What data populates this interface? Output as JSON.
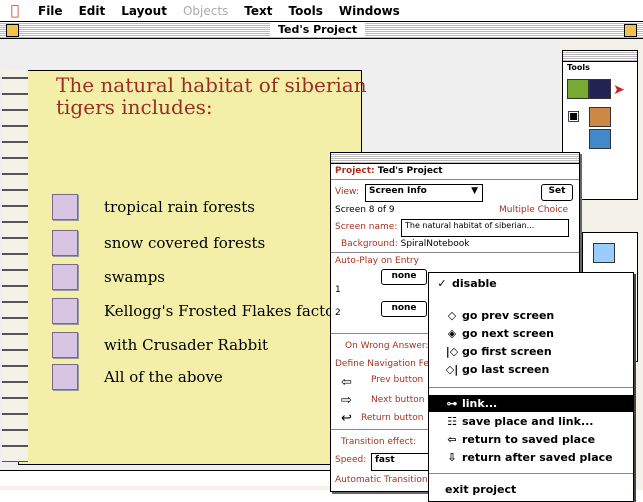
{
  "menubar": {
    "items": [
      {
        "label": "File",
        "enabled": true
      },
      {
        "label": "Edit",
        "enabled": true
      },
      {
        "label": "Layout",
        "enabled": true
      },
      {
        "label": "Objects",
        "enabled": false
      },
      {
        "label": "Text",
        "enabled": true
      },
      {
        "label": "Tools",
        "enabled": true
      },
      {
        "label": "Windows",
        "enabled": true
      }
    ]
  },
  "window": {
    "title": "Ted's Project"
  },
  "screen": {
    "question": "The natural habitat of siberian tigers includes:",
    "choices": [
      "tropical rain forests",
      "snow covered forests",
      "swamps",
      "Kellogg's Frosted Flakes factor",
      "with Crusader Rabbit",
      "All of the above"
    ],
    "colors": {
      "page": "#f3efa9",
      "question": "#9a2e23",
      "checkbox": "#d7c5e3"
    }
  },
  "tools_palette": {
    "title": "Tools"
  },
  "project_dialog": {
    "project_label": "Project:",
    "project_name": "Ted's Project",
    "view_label": "View:",
    "view_value": "Screen Info",
    "set_button": "Set",
    "screen_of": "Screen 8 of 9",
    "screen_type": "Multiple Choice",
    "screen_name_label": "Screen name:",
    "screen_name_value": "The natural habitat of siberian...",
    "background_label": "Background:",
    "background_value": "SpiralNotebook",
    "autoplay_label": "Auto-Play on Entry",
    "row1_num": "1",
    "row2_num": "2",
    "row1_value": "none",
    "row2_value": "none",
    "on_wrong_answer": "On Wrong Answer:",
    "define_nav": "Define Navigation Fe",
    "prev_button": "Prev button",
    "next_button": "Next button",
    "return_button": "Return button",
    "transition_effect": "Transition effect:",
    "speed_label": "Speed:",
    "speed_value": "fast",
    "auto_transition": "Automatic Transition"
  },
  "popup_menu": {
    "items": [
      {
        "label": "disable",
        "icon": "checkmark-icon",
        "glyph": "✓",
        "selected": false
      },
      {
        "label": "go prev screen",
        "icon": "prev-screen-icon",
        "glyph": "◇",
        "selected": false
      },
      {
        "label": "go next screen",
        "icon": "next-screen-icon",
        "glyph": "◈",
        "selected": false
      },
      {
        "label": "go first screen",
        "icon": "first-screen-icon",
        "glyph": "|◇",
        "selected": false
      },
      {
        "label": "go last screen",
        "icon": "last-screen-icon",
        "glyph": "◇|",
        "selected": false
      },
      {
        "label": "link...",
        "icon": "link-icon",
        "glyph": "⊶",
        "selected": true
      },
      {
        "label": "save place and link...",
        "icon": "save-place-icon",
        "glyph": "☷",
        "selected": false
      },
      {
        "label": "return to saved place",
        "icon": "return-icon",
        "glyph": "⇦",
        "selected": false
      },
      {
        "label": "return after saved place",
        "icon": "return-after-icon",
        "glyph": "⇩",
        "selected": false
      },
      {
        "label": "exit project",
        "icon": "",
        "glyph": "",
        "selected": false
      }
    ]
  }
}
